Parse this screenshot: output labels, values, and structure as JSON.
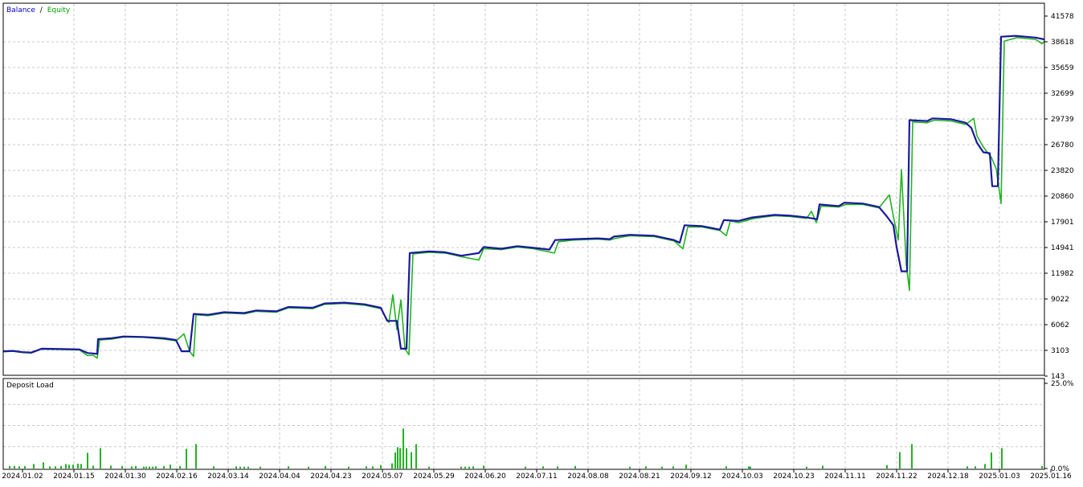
{
  "legend": {
    "balance_label": "Balance",
    "separator": "/",
    "equity_label": "Equity",
    "balance_color": "#1a1a9c",
    "equity_color": "#22b322"
  },
  "deposit_panel": {
    "title": "Deposit Load",
    "bar_color": "#22b322"
  },
  "chart_data": [
    {
      "type": "line",
      "title": "",
      "legend": [
        "Balance",
        "Equity"
      ],
      "legend_position": "top-left",
      "grid": true,
      "y_axis_side": "right",
      "ylim": [
        143,
        41578
      ],
      "y_ticks": [
        "143",
        "3103",
        "6062",
        "9022",
        "11982",
        "14941",
        "17901",
        "20860",
        "23820",
        "26780",
        "29739",
        "32699",
        "35659",
        "38618",
        "41578"
      ],
      "x_ticks": [
        "2024.01.02",
        "2024.01.15",
        "2024.01.30",
        "2024.02.16",
        "2024.03.14",
        "2024.04.04",
        "2024.04.23",
        "2024.05.07",
        "2024.05.29",
        "2024.06.20",
        "2024.07.11",
        "2024.08.08",
        "2024.08.21",
        "2024.09.12",
        "2024.10.03",
        "2024.10.23",
        "2024.11.11",
        "2024.11.22",
        "2024.12.18",
        "2025.01.03",
        "2025.01.16"
      ],
      "series": [
        {
          "name": "Balance",
          "color": "#1a1a9c",
          "points": [
            [
              0,
              3000
            ],
            [
              12,
              3050
            ],
            [
              24,
              2900
            ],
            [
              35,
              2850
            ],
            [
              48,
              3300
            ],
            [
              75,
              3250
            ],
            [
              95,
              3200
            ],
            [
              105,
              2800
            ],
            [
              112,
              2750
            ],
            [
              117,
              2700
            ],
            [
              118,
              4400
            ],
            [
              135,
              4500
            ],
            [
              150,
              4700
            ],
            [
              175,
              4650
            ],
            [
              200,
              4500
            ],
            [
              215,
              4300
            ],
            [
              222,
              3000
            ],
            [
              232,
              3000
            ],
            [
              237,
              7300
            ],
            [
              255,
              7200
            ],
            [
              275,
              7500
            ],
            [
              300,
              7400
            ],
            [
              315,
              7700
            ],
            [
              340,
              7600
            ],
            [
              355,
              8100
            ],
            [
              385,
              8000
            ],
            [
              400,
              8500
            ],
            [
              425,
              8600
            ],
            [
              450,
              8400
            ],
            [
              470,
              8000
            ],
            [
              478,
              6500
            ],
            [
              490,
              6500
            ],
            [
              495,
              3300
            ],
            [
              502,
              3300
            ],
            [
              506,
              14300
            ],
            [
              530,
              14500
            ],
            [
              550,
              14400
            ],
            [
              570,
              14000
            ],
            [
              592,
              14300
            ],
            [
              598,
              15000
            ],
            [
              620,
              14800
            ],
            [
              640,
              15100
            ],
            [
              660,
              14900
            ],
            [
              680,
              14700
            ],
            [
              687,
              15800
            ],
            [
              710,
              15900
            ],
            [
              740,
              16000
            ],
            [
              755,
              15900
            ],
            [
              760,
              16200
            ],
            [
              780,
              16400
            ],
            [
              810,
              16300
            ],
            [
              835,
              15800
            ],
            [
              842,
              15500
            ],
            [
              848,
              17500
            ],
            [
              870,
              17400
            ],
            [
              892,
              17000
            ],
            [
              897,
              18100
            ],
            [
              915,
              18000
            ],
            [
              932,
              18400
            ],
            [
              960,
              18700
            ],
            [
              980,
              18600
            ],
            [
              1000,
              18400
            ],
            [
              1013,
              18200
            ],
            [
              1016,
              19900
            ],
            [
              1040,
              19700
            ],
            [
              1047,
              20100
            ],
            [
              1070,
              20000
            ],
            [
              1090,
              19600
            ],
            [
              1100,
              18500
            ],
            [
              1108,
              17500
            ],
            [
              1112,
              15000
            ],
            [
              1118,
              12200
            ],
            [
              1125,
              12200
            ],
            [
              1128,
              29600
            ],
            [
              1150,
              29500
            ],
            [
              1157,
              29800
            ],
            [
              1180,
              29700
            ],
            [
              1198,
              29300
            ],
            [
              1205,
              28700
            ],
            [
              1212,
              27000
            ],
            [
              1220,
              25900
            ],
            [
              1228,
              25800
            ],
            [
              1231,
              22000
            ],
            [
              1238,
              22000
            ],
            [
              1242,
              39200
            ],
            [
              1260,
              39300
            ],
            [
              1285,
              39100
            ],
            [
              1296,
              38900
            ]
          ]
        },
        {
          "name": "Equity",
          "color": "#22b322",
          "points": [
            [
              0,
              2950
            ],
            [
              12,
              3000
            ],
            [
              24,
              2850
            ],
            [
              35,
              2800
            ],
            [
              48,
              3250
            ],
            [
              75,
              3200
            ],
            [
              95,
              3150
            ],
            [
              105,
              2500
            ],
            [
              112,
              2550
            ],
            [
              117,
              2200
            ],
            [
              120,
              4300
            ],
            [
              135,
              4400
            ],
            [
              150,
              4650
            ],
            [
              175,
              4600
            ],
            [
              200,
              4400
            ],
            [
              215,
              4200
            ],
            [
              225,
              5000
            ],
            [
              232,
              3000
            ],
            [
              237,
              2400
            ],
            [
              240,
              7200
            ],
            [
              255,
              7100
            ],
            [
              275,
              7400
            ],
            [
              300,
              7300
            ],
            [
              315,
              7600
            ],
            [
              340,
              7500
            ],
            [
              355,
              8000
            ],
            [
              385,
              7900
            ],
            [
              400,
              8400
            ],
            [
              425,
              8500
            ],
            [
              450,
              8300
            ],
            [
              470,
              7900
            ],
            [
              480,
              6300
            ],
            [
              485,
              9500
            ],
            [
              490,
              5500
            ],
            [
              495,
              8900
            ],
            [
              500,
              3300
            ],
            [
              505,
              2600
            ],
            [
              510,
              14200
            ],
            [
              530,
              14400
            ],
            [
              550,
              14300
            ],
            [
              570,
              13900
            ],
            [
              592,
              13500
            ],
            [
              598,
              14800
            ],
            [
              620,
              14700
            ],
            [
              640,
              15000
            ],
            [
              660,
              14800
            ],
            [
              686,
              14300
            ],
            [
              691,
              15600
            ],
            [
              710,
              15800
            ],
            [
              740,
              15900
            ],
            [
              755,
              15800
            ],
            [
              762,
              16000
            ],
            [
              780,
              16300
            ],
            [
              810,
              16200
            ],
            [
              835,
              15700
            ],
            [
              846,
              14800
            ],
            [
              852,
              17300
            ],
            [
              870,
              17300
            ],
            [
              892,
              16900
            ],
            [
              900,
              16300
            ],
            [
              905,
              18000
            ],
            [
              915,
              17800
            ],
            [
              935,
              18300
            ],
            [
              960,
              18600
            ],
            [
              980,
              18500
            ],
            [
              1000,
              18300
            ],
            [
              1006,
              19100
            ],
            [
              1012,
              17800
            ],
            [
              1018,
              19700
            ],
            [
              1040,
              19600
            ],
            [
              1049,
              19900
            ],
            [
              1070,
              19900
            ],
            [
              1090,
              19500
            ],
            [
              1103,
              21000
            ],
            [
              1108,
              18500
            ],
            [
              1114,
              15800
            ],
            [
              1118,
              23900
            ],
            [
              1124,
              13000
            ],
            [
              1128,
              10000
            ],
            [
              1132,
              29400
            ],
            [
              1150,
              29300
            ],
            [
              1159,
              29600
            ],
            [
              1180,
              29500
            ],
            [
              1198,
              29100
            ],
            [
              1208,
              29800
            ],
            [
              1212,
              27800
            ],
            [
              1220,
              26500
            ],
            [
              1230,
              25300
            ],
            [
              1236,
              24000
            ],
            [
              1242,
              20000
            ],
            [
              1246,
              38700
            ],
            [
              1262,
              39100
            ],
            [
              1285,
              38900
            ],
            [
              1293,
              38400
            ],
            [
              1296,
              38700
            ]
          ]
        }
      ]
    },
    {
      "type": "bar",
      "title": "Deposit Load",
      "ylim": [
        0,
        25
      ],
      "y_ticks": [
        "0.0%",
        "25.0%"
      ],
      "series": [
        {
          "name": "Deposit Load",
          "bars": [
            [
              8,
              0.5
            ],
            [
              14,
              0.5
            ],
            [
              20,
              0.4
            ],
            [
              27,
              0.5
            ],
            [
              38,
              1.1
            ],
            [
              50,
              1.6
            ],
            [
              58,
              0.4
            ],
            [
              65,
              0.4
            ],
            [
              72,
              0.5
            ],
            [
              78,
              1.1
            ],
            [
              82,
              0.9
            ],
            [
              87,
              0.9
            ],
            [
              93,
              1.2
            ],
            [
              97,
              1.1
            ],
            [
              105,
              4.4
            ],
            [
              112,
              0.6
            ],
            [
              121,
              5.8
            ],
            [
              134,
              0.6
            ],
            [
              148,
              0.5
            ],
            [
              160,
              0.4
            ],
            [
              165,
              0.5
            ],
            [
              175,
              0.3
            ],
            [
              178,
              0.3
            ],
            [
              182,
              0.3
            ],
            [
              186,
              0.3
            ],
            [
              190,
              0.4
            ],
            [
              200,
              0.5
            ],
            [
              208,
              0.9
            ],
            [
              220,
              0.5
            ],
            [
              228,
              5.6
            ],
            [
              240,
              7.0
            ],
            [
              262,
              0.4
            ],
            [
              290,
              0.4
            ],
            [
              295,
              0.3
            ],
            [
              300,
              0.3
            ],
            [
              305,
              0.3
            ],
            [
              320,
              0.3
            ],
            [
              355,
              0.4
            ],
            [
              380,
              0.3
            ],
            [
              401,
              0.5
            ],
            [
              430,
              0.3
            ],
            [
              452,
              0.4
            ],
            [
              460,
              0.4
            ],
            [
              470,
              0.8
            ],
            [
              484,
              1.3
            ],
            [
              488,
              4.5
            ],
            [
              491,
              6.1
            ],
            [
              494,
              5.8
            ],
            [
              498,
              11.6
            ],
            [
              502,
              5.8
            ],
            [
              508,
              4.6
            ],
            [
              514,
              7.0
            ],
            [
              530,
              0.3
            ],
            [
              570,
              0.3
            ],
            [
              575,
              0.3
            ],
            [
              580,
              0.3
            ],
            [
              585,
              0.4
            ],
            [
              598,
              0.6
            ],
            [
              650,
              0.3
            ],
            [
              672,
              0.4
            ],
            [
              690,
              0.4
            ],
            [
              712,
              0.5
            ],
            [
              780,
              0.3
            ],
            [
              800,
              0.4
            ],
            [
              820,
              0.3
            ],
            [
              834,
              0.4
            ],
            [
              850,
              0.9
            ],
            [
              900,
              0.4
            ],
            [
              928,
              0.4
            ],
            [
              930,
              0.3
            ],
            [
              1000,
              0.3
            ],
            [
              1020,
              0.6
            ],
            [
              1100,
              0.8
            ],
            [
              1116,
              4.6
            ],
            [
              1131,
              7.0
            ],
            [
              1200,
              0.4
            ],
            [
              1210,
              0.4
            ],
            [
              1222,
              1.1
            ],
            [
              1230,
              4.5
            ],
            [
              1243,
              5.8
            ],
            [
              1293,
              0.5
            ]
          ]
        }
      ]
    }
  ]
}
